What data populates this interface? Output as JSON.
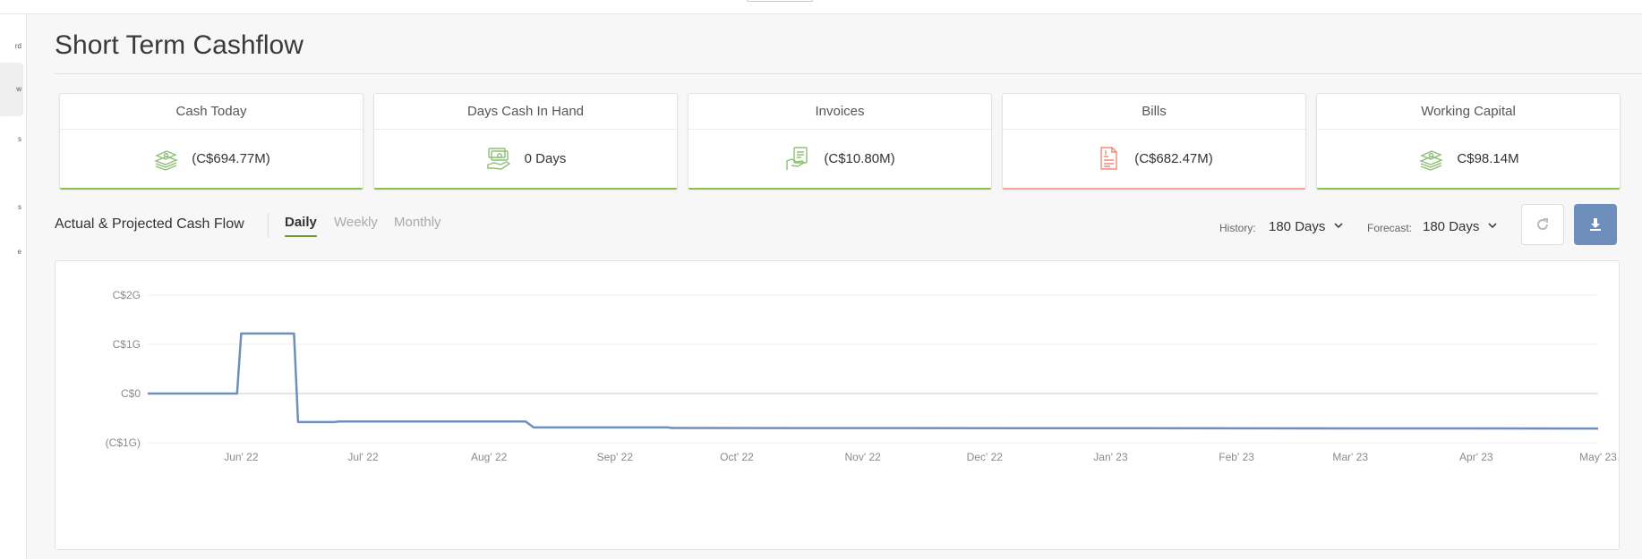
{
  "page": {
    "title": "Short Term Cashflow"
  },
  "sidebar": {
    "items": [
      {
        "label": "rd"
      },
      {
        "label": "w"
      },
      {
        "label": "s"
      },
      {
        "label": "s"
      },
      {
        "label": "e"
      }
    ]
  },
  "cards": [
    {
      "title": "Cash Today",
      "value": "(C$694.77M)",
      "icon": "money-stack-icon",
      "status": "positive"
    },
    {
      "title": "Days Cash In Hand",
      "value": "0 Days",
      "icon": "money-hand-icon",
      "status": "positive"
    },
    {
      "title": "Invoices",
      "value": "(C$10.80M)",
      "icon": "invoice-hand-icon",
      "status": "positive"
    },
    {
      "title": "Bills",
      "value": "(C$682.47M)",
      "icon": "bill-document-icon",
      "status": "negative"
    },
    {
      "title": "Working Capital",
      "value": "C$98.14M",
      "icon": "money-stack-icon",
      "status": "positive"
    }
  ],
  "chart_header": {
    "title": "Actual & Projected Cash Flow",
    "tabs": [
      {
        "label": "Daily",
        "active": true
      },
      {
        "label": "Weekly",
        "active": false
      },
      {
        "label": "Monthly",
        "active": false
      }
    ],
    "history_label": "History:",
    "history_value": "180 Days",
    "forecast_label": "Forecast:",
    "forecast_value": "180 Days"
  },
  "colors": {
    "positive": "#8bc34a",
    "negative": "#f4a497",
    "line": "#6e8fbc",
    "icon_green": "#8dbf75",
    "icon_red": "#f08a76"
  },
  "chart_data": {
    "type": "line",
    "title": "",
    "xlabel": "",
    "ylabel": "",
    "y_tick_labels": [
      "C$2G",
      "C$1G",
      "C$0",
      "(C$1G)"
    ],
    "y_tick_values": [
      2,
      1,
      0,
      -1
    ],
    "ylim": [
      -1,
      2
    ],
    "y_units": "billions C$",
    "x_tick_labels": [
      "Jun' 22",
      "Jul' 22",
      "Aug' 22",
      "Sep' 22",
      "Oct' 22",
      "Nov' 22",
      "Dec' 22",
      "Jan' 23",
      "Feb' 23",
      "Mar' 23",
      "Apr' 23",
      "May' 23"
    ],
    "x_tick_dates": [
      "2022-06-01",
      "2022-07-01",
      "2022-08-01",
      "2022-09-01",
      "2022-10-01",
      "2022-11-01",
      "2022-12-01",
      "2023-01-01",
      "2023-02-01",
      "2023-03-01",
      "2023-04-01",
      "2023-05-01"
    ],
    "xlim": [
      "2022-05-09",
      "2023-05-01"
    ],
    "grid": true,
    "legend": "none",
    "series": [
      {
        "points": [
          [
            "2022-05-09",
            0.0
          ],
          [
            "2022-05-31",
            0.0
          ],
          [
            "2022-06-01",
            1.22
          ],
          [
            "2022-06-14",
            1.22
          ],
          [
            "2022-06-15",
            -0.58
          ],
          [
            "2022-06-24",
            -0.58
          ],
          [
            "2022-06-25",
            -0.57
          ],
          [
            "2022-08-10",
            -0.57
          ],
          [
            "2022-08-12",
            -0.69
          ],
          [
            "2022-09-14",
            -0.69
          ],
          [
            "2022-09-15",
            -0.7
          ],
          [
            "2023-05-01",
            -0.71
          ]
        ]
      }
    ]
  }
}
